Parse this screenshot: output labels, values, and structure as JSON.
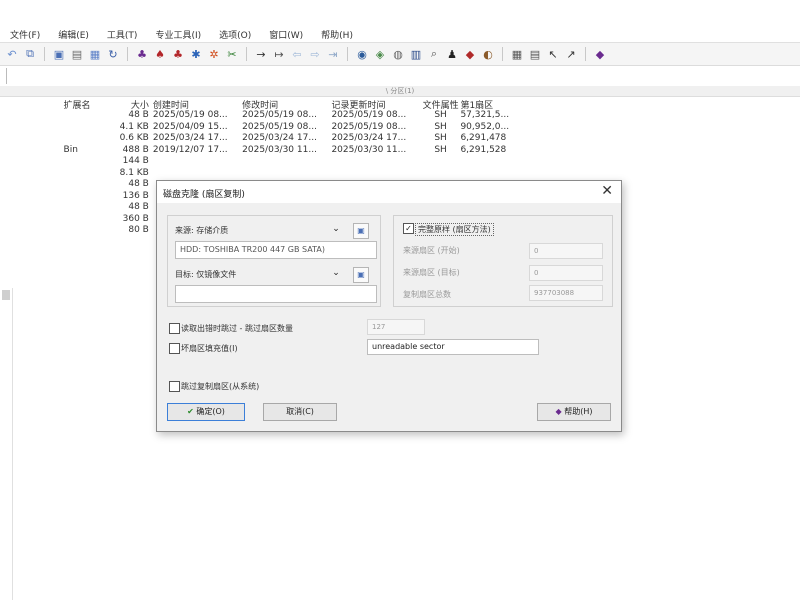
{
  "menu": {
    "items": [
      "文件(F)",
      "编辑(E)",
      "工具(T)",
      "专业工具(I)",
      "选项(O)",
      "窗口(W)",
      "帮助(H)"
    ]
  },
  "addressbar": {
    "subheader": "\\ 分区(1)"
  },
  "table": {
    "headers": [
      "",
      "扩展名",
      "大小",
      "创建时间",
      "修改时间",
      "记录更新时间",
      "文件属性",
      "第1扇区"
    ],
    "rows": [
      {
        "ext": "",
        "size": "48 B",
        "created": "2025/05/19  08...",
        "modified": "2025/05/19  08...",
        "updated": "2025/05/19  08...",
        "attr": "SH",
        "sector": "57,321,5..."
      },
      {
        "ext": "",
        "size": "4.1 KB",
        "created": "2025/04/09  15...",
        "modified": "2025/05/19  08...",
        "updated": "2025/05/19  08...",
        "attr": "SH",
        "sector": "90,952,0..."
      },
      {
        "ext": "",
        "size": "0.6 KB",
        "created": "2025/03/24  17...",
        "modified": "2025/03/24  17...",
        "updated": "2025/03/24  17...",
        "attr": "SH",
        "sector": "6,291,478"
      },
      {
        "ext": "Bin",
        "size": "488 B",
        "created": "2019/12/07  17...",
        "modified": "2025/03/30  11...",
        "updated": "2025/03/30  11...",
        "attr": "SH",
        "sector": "6,291,528"
      },
      {
        "ext": "",
        "size": "144 B",
        "created": "",
        "modified": "",
        "updated": "",
        "attr": "",
        "sector": ""
      },
      {
        "ext": "",
        "size": "8.1 KB",
        "created": "",
        "modified": "",
        "updated": "",
        "attr": "",
        "sector": ""
      },
      {
        "ext": "",
        "size": "48 B",
        "created": "",
        "modified": "",
        "updated": "",
        "attr": "",
        "sector": ""
      },
      {
        "ext": "",
        "size": "136 B",
        "created": "",
        "modified": "",
        "updated": "",
        "attr": "",
        "sector": ""
      },
      {
        "ext": "",
        "size": "48 B",
        "created": "",
        "modified": "",
        "updated": "",
        "attr": "",
        "sector": ""
      },
      {
        "ext": "",
        "size": "360 B",
        "created": "",
        "modified": "",
        "updated": "",
        "attr": "",
        "sector": ""
      },
      {
        "ext": "",
        "size": "80 B",
        "created": "",
        "modified": "",
        "updated": "",
        "attr": "",
        "sector": ""
      }
    ]
  },
  "dialog": {
    "title": "磁盘克隆 (扇区复制)",
    "close": "✕",
    "source_label": "来源: 存储介质",
    "source_value": "HDD: TOSHIBA TR200 447 GB SATA)",
    "target_label": "目标: 仅镜像文件",
    "target_value": "",
    "copy_sector_label": "完整原样 (扇区方法)",
    "start_sector_label": "来源扇区 (开始)",
    "start_sector_value": "0",
    "target_sector_label": "来源扇区 (目标)",
    "target_sector_value": "0",
    "count_label": "复制扇区总数",
    "count_value": "937703088",
    "skip_bad_label": "读取出错时跳过 - 跳过扇区数量",
    "skip_bad_value": "127",
    "mark_bad_label": "坏扇区填充值(I)",
    "mark_bad_value": "unreadable sector",
    "avoid_label": "跳过复制扇区(从系统)",
    "ok_label": "确定(O)",
    "cancel_label": "取消(C)",
    "help_label": "帮助(H)"
  }
}
